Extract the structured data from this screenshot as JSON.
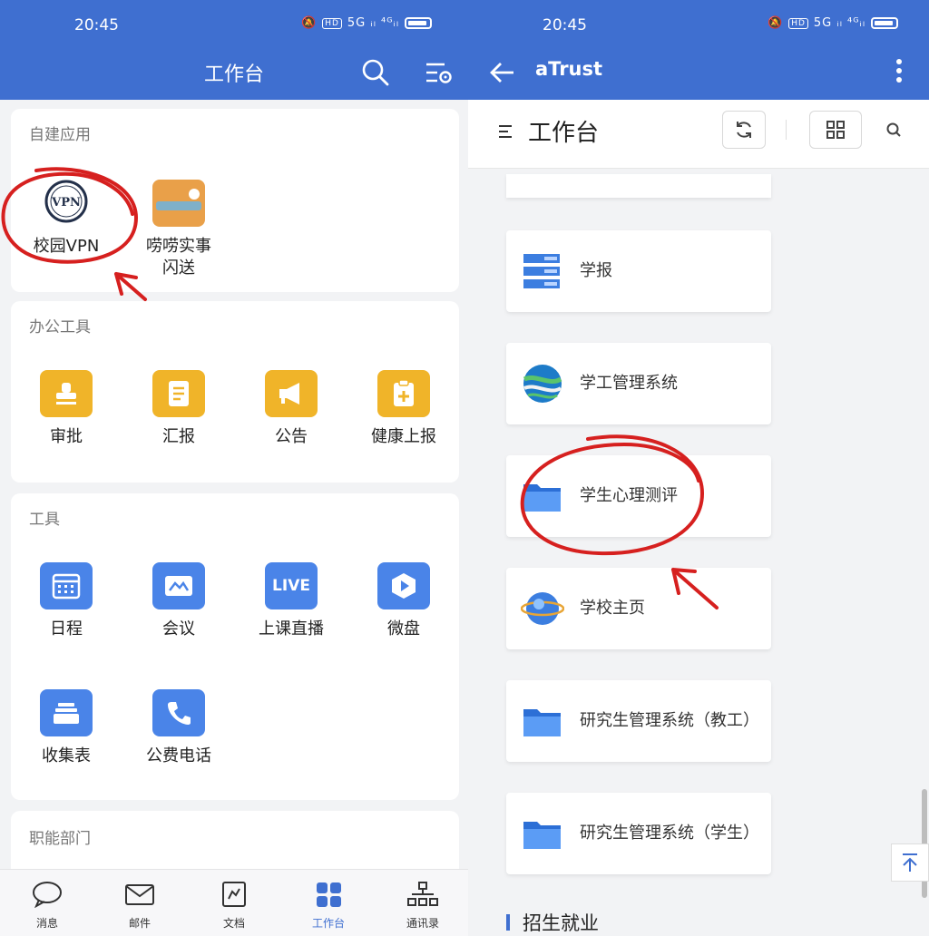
{
  "left": {
    "status": {
      "time": "20:45",
      "hd": "HD",
      "signal": "5G ᵢₗ ⁴ᴳᵢₗ"
    },
    "title": "工作台",
    "sections": {
      "self_apps": {
        "title": "自建应用",
        "apps": [
          {
            "label": "校园VPN",
            "icon_text": "VPN"
          },
          {
            "label": "唠唠实事\n闪送"
          }
        ]
      },
      "office": {
        "title": "办公工具",
        "apps": [
          {
            "label": "审批"
          },
          {
            "label": "汇报"
          },
          {
            "label": "公告"
          },
          {
            "label": "健康上报"
          }
        ]
      },
      "tools": {
        "title": "工具",
        "apps": [
          {
            "label": "日程"
          },
          {
            "label": "会议"
          },
          {
            "label": "上课直播",
            "icon_text": "LIVE"
          },
          {
            "label": "微盘"
          },
          {
            "label": "收集表"
          },
          {
            "label": "公费电话"
          }
        ]
      },
      "departments": {
        "title": "职能部门"
      }
    },
    "nav": [
      {
        "label": "消息"
      },
      {
        "label": "邮件"
      },
      {
        "label": "文档"
      },
      {
        "label": "工作台"
      },
      {
        "label": "通讯录"
      }
    ]
  },
  "right": {
    "status": {
      "time": "20:45",
      "hd": "HD",
      "signal": "5G ᵢₗ ⁴ᴳᵢₗ"
    },
    "app_title": "aTrust",
    "page_title": "工作台",
    "list": [
      {
        "label": "学报"
      },
      {
        "label": "学工管理系统"
      },
      {
        "label": "学生心理测评"
      },
      {
        "label": "学校主页"
      },
      {
        "label": "研究生管理系统（教工）"
      },
      {
        "label": "研究生管理系统（学生）"
      }
    ],
    "section": "招生就业"
  },
  "colors": {
    "header_blue": "#3f6fd0",
    "app_yellow": "#f0b429",
    "app_blue": "#4a84e8",
    "annotation_red": "#d6201f"
  }
}
